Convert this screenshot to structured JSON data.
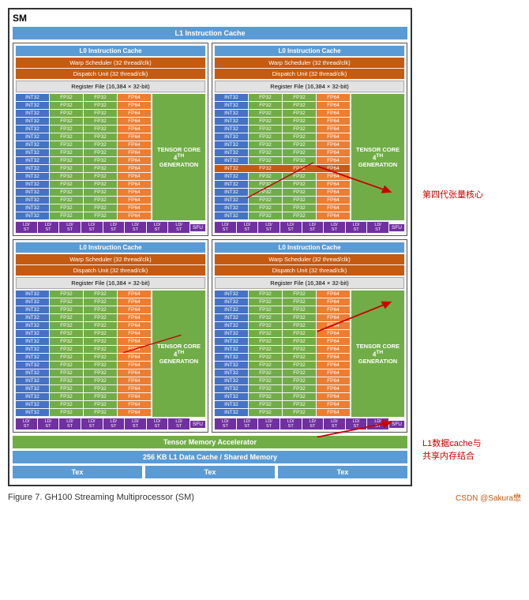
{
  "title": "SM",
  "l1_instruction_cache": "L1 Instruction Cache",
  "l0_instruction_cache": "L0 Instruction Cache",
  "warp_scheduler": "Warp Scheduler (32 thread/clk)",
  "dispatch_unit": "Dispatch Unit (32 thread/clk)",
  "register_file": "Register File (16,384 × 32-bit)",
  "tensor_core": {
    "label": "TENSOR CORE",
    "generation": "4TH GENERATION"
  },
  "ld_st": "LD/ST",
  "sfu": "SFU",
  "tensor_memory_accelerator": "Tensor Memory Accelerator",
  "l1_data_cache": "256 KB L1 Data Cache / Shared Memory",
  "tex": "Tex",
  "figure_caption": "Figure 7.    GH100 Streaming Multiprocessor (SM)",
  "figure_source": "CSDN @Sakura懋",
  "annotation_1": "第四代张量核心",
  "annotation_2": "L1数据cache与\n共享内存结合",
  "core_rows": [
    {
      "int32": "INT32",
      "fp32a": "FP32",
      "fp32b": "FP32",
      "fp64": "FP64"
    },
    {
      "int32": "INT32",
      "fp32a": "FP32",
      "fp32b": "FP32",
      "fp64": "FP64"
    },
    {
      "int32": "INT32",
      "fp32a": "FP32",
      "fp32b": "FP32",
      "fp64": "FP64"
    },
    {
      "int32": "INT32",
      "fp32a": "FP32",
      "fp32b": "FP32",
      "fp64": "FP64"
    },
    {
      "int32": "INT32",
      "fp32a": "FP32",
      "fp32b": "FP32",
      "fp64": "FP64"
    },
    {
      "int32": "INT32",
      "fp32a": "FP32",
      "fp32b": "FP32",
      "fp64": "FP64"
    },
    {
      "int32": "INT32",
      "fp32a": "FP32",
      "fp32b": "FP32",
      "fp64": "FP64"
    },
    {
      "int32": "INT32",
      "fp32a": "FP32",
      "fp32b": "FP32",
      "fp64": "FP64"
    },
    {
      "int32": "INT32",
      "fp32a": "FP32",
      "fp32b": "FP32",
      "fp64": "FP64"
    },
    {
      "int32": "INT32",
      "fp32a": "FP32",
      "fp32b": "FP32",
      "fp64": "FP64"
    },
    {
      "int32": "INT32",
      "fp32a": "FP32",
      "fp32b": "FP32",
      "fp64": "FP64"
    },
    {
      "int32": "INT32",
      "fp32a": "FP32",
      "fp32b": "FP32",
      "fp64": "FP64"
    },
    {
      "int32": "INT32",
      "fp32a": "FP32",
      "fp32b": "FP32",
      "fp64": "FP64"
    },
    {
      "int32": "INT32",
      "fp32a": "FP32",
      "fp32b": "FP32",
      "fp64": "FP64"
    },
    {
      "int32": "INT32",
      "fp32a": "FP32",
      "fp32b": "FP32",
      "fp64": "FP64"
    },
    {
      "int32": "INT32",
      "fp32a": "FP32",
      "fp32b": "FP32",
      "fp64": "FP64"
    }
  ]
}
